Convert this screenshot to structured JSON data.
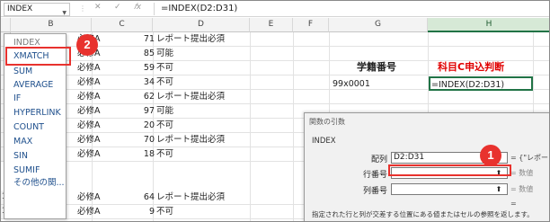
{
  "namebox": {
    "value": "INDEX"
  },
  "formula_bar": {
    "cancel": "✕",
    "enter": "✓",
    "fx": "𝑓x",
    "formula": "=INDEX(D2:D31)"
  },
  "columns": [
    "B",
    "C",
    "D",
    "E",
    "F",
    "G",
    "H"
  ],
  "rows": [
    {
      "num": "",
      "b": "必修A",
      "c": "71",
      "d": "レポート提出必須"
    },
    {
      "num": "",
      "b": "必修A",
      "c": "85",
      "d": "可能"
    },
    {
      "num": "",
      "b": "必修A",
      "c": "59",
      "d": "不可"
    },
    {
      "num": "",
      "b": "必修A",
      "c": "34",
      "d": "不可"
    },
    {
      "num": "",
      "b": "必修A",
      "c": "62",
      "d": "レポート提出必須"
    },
    {
      "num": "",
      "b": "必修A",
      "c": "97",
      "d": "可能"
    },
    {
      "num": "",
      "b": "必修A",
      "c": "20",
      "d": "不可"
    },
    {
      "num": "",
      "b": "必修A",
      "c": "70",
      "d": "レポート提出必須"
    },
    {
      "num": "",
      "b": "必修A",
      "c": "18",
      "d": "不可"
    },
    {
      "num": "11",
      "a": "99x0010",
      "b": "必修A",
      "c": "64",
      "d": "レポート提出必須"
    },
    {
      "num": "12",
      "a": "99x0011",
      "b": "必修A",
      "c": "9",
      "d": "不可"
    }
  ],
  "g_header": "学籍番号",
  "h_header": "科目C申込判断",
  "g_value": "99x0001",
  "h_value": "=INDEX(D2:D31)",
  "dropdown": {
    "items": [
      "INDEX",
      "XMATCH",
      "SUM",
      "AVERAGE",
      "IF",
      "HYPERLINK",
      "COUNT",
      "MAX",
      "SIN",
      "SUMIF",
      "その他の関..."
    ]
  },
  "badges": {
    "one": "1",
    "two": "2"
  },
  "dialog": {
    "title": "関数の引数",
    "function_name": "INDEX",
    "args": [
      {
        "label": "配列",
        "value": "D2:D31",
        "result": "= {\"レポー"
      },
      {
        "label": "行番号",
        "value": "",
        "result": "= 数値"
      },
      {
        "label": "列番号",
        "value": "",
        "result": "= 数値"
      }
    ],
    "eq_only": "=",
    "description": "指定された行と列が交差する位置にある値またはセルの参照を返します。"
  }
}
